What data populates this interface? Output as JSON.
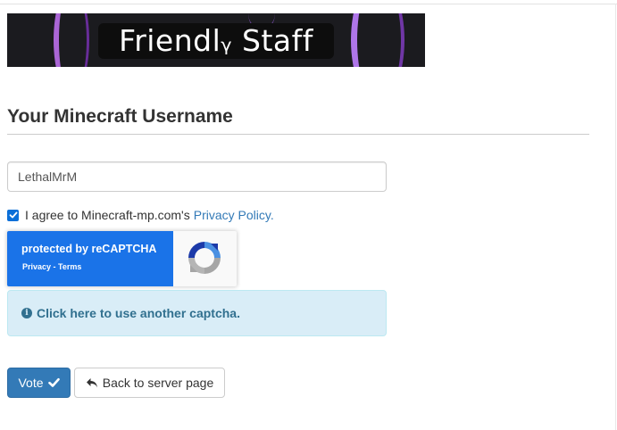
{
  "banner": {
    "text": "Friendlᵧ Staff"
  },
  "form": {
    "title": "Your Minecraft Username",
    "username_value": "LethalMrM",
    "agree_checked": true,
    "agree_text": "I agree to Minecraft-mp.com's",
    "agree_link": "Privacy Policy.",
    "recaptcha": {
      "protected_text": "protected by reCAPTCHA",
      "privacy_text": "Privacy - Terms"
    },
    "alternate_captcha": "Click here to use another captcha.",
    "vote_label": "Vote",
    "back_label": "Back to server page"
  },
  "colors": {
    "primary": "#337ab7",
    "recaptcha_blue": "#1a73e8",
    "alert_bg": "#d9edf7",
    "alert_text": "#31708f"
  },
  "icons": [
    "check-icon",
    "info-circle-icon",
    "reply-arrow-icon",
    "recaptcha-logo-icon"
  ]
}
